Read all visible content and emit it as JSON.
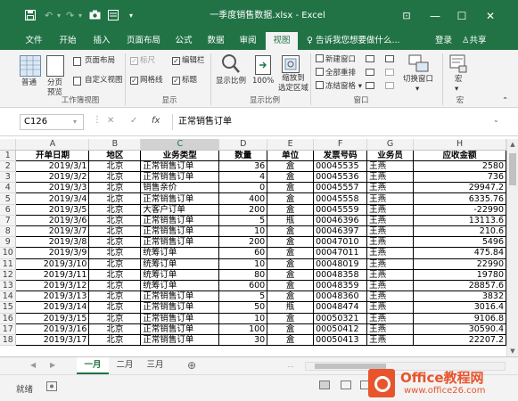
{
  "titlebar": {
    "save_icon": "save-icon",
    "undo_icon": "undo-icon",
    "redo_icon": "redo-icon",
    "camera_icon": "camera-icon",
    "form_icon": "form-icon",
    "customize": "▾",
    "title": "一季度销售数据.xlsx - Excel",
    "ribbon_display": "⊡",
    "minimize": "—",
    "maximize": "☐",
    "close": "✕"
  },
  "tabs": {
    "items": [
      "文件",
      "开始",
      "插入",
      "页面布局",
      "公式",
      "数据",
      "审阅",
      "视图"
    ],
    "active": "视图",
    "tell_me": "♀ 告诉我您想要做什么...",
    "login": "登录",
    "share": "共享"
  },
  "ribbon": {
    "workbook_views": {
      "normal": "普通",
      "page_break": "分页\n预览",
      "page_layout": "页面布局",
      "custom_views": "自定义视图",
      "label": "工作簿视图"
    },
    "show": {
      "ruler": "标尺",
      "formula_bar": "编辑栏",
      "gridlines": "网格线",
      "headings": "标题",
      "label": "显示"
    },
    "zoom": {
      "zoom": "显示比例",
      "hundred": "100%",
      "zoom_to_selection": "缩放到\n选定区域",
      "label": "显示比例"
    },
    "window": {
      "new_window": "新建窗口",
      "arrange_all": "全部重排",
      "freeze_panes": "冻结窗格",
      "switch_windows": "切换窗口",
      "label": "窗口"
    },
    "macros": {
      "macros": "宏",
      "label": "宏"
    }
  },
  "formula_bar": {
    "cell_ref": "C126",
    "cancel": "✕",
    "enter": "✓",
    "fx": "fx",
    "value": "正常销售订单"
  },
  "grid": {
    "columns": [
      "A",
      "B",
      "C",
      "D",
      "E",
      "F",
      "G",
      "H"
    ],
    "headers": [
      "开单日期",
      "地区",
      "业务类型",
      "数量",
      "单位",
      "发票号码",
      "业务员",
      "应收金额"
    ],
    "rows": [
      [
        "2019/3/1",
        "北京",
        "正常销售订单",
        "36",
        "盒",
        "00045535",
        "王燕",
        "2580"
      ],
      [
        "2019/3/2",
        "北京",
        "正常销售订单",
        "4",
        "盒",
        "00045536",
        "王燕",
        "736"
      ],
      [
        "2019/3/3",
        "北京",
        "销售亲价",
        "0",
        "盒",
        "00045557",
        "王燕",
        "29947.2"
      ],
      [
        "2019/3/4",
        "北京",
        "正常销售订单",
        "400",
        "盒",
        "00045558",
        "王燕",
        "6335.76"
      ],
      [
        "2019/3/5",
        "北京",
        "大客户订单",
        "200",
        "盒",
        "00045559",
        "王燕",
        "-22990"
      ],
      [
        "2019/3/6",
        "北京",
        "正常销售订单",
        "5",
        "瓶",
        "00046396",
        "王燕",
        "13113.6"
      ],
      [
        "2019/3/7",
        "北京",
        "正常销售订单",
        "10",
        "盒",
        "00046397",
        "王燕",
        "210.6"
      ],
      [
        "2019/3/8",
        "北京",
        "正常销售订单",
        "200",
        "盒",
        "00047010",
        "王燕",
        "5496"
      ],
      [
        "2019/3/9",
        "北京",
        "统筹订单",
        "60",
        "盒",
        "00047011",
        "王燕",
        "475.84"
      ],
      [
        "2019/3/10",
        "北京",
        "统筹订单",
        "10",
        "盒",
        "00048019",
        "王燕",
        "22990"
      ],
      [
        "2019/3/11",
        "北京",
        "统筹订单",
        "80",
        "盒",
        "00048358",
        "王燕",
        "19780"
      ],
      [
        "2019/3/12",
        "北京",
        "统筹订单",
        "600",
        "盒",
        "00048359",
        "王燕",
        "28857.6"
      ],
      [
        "2019/3/13",
        "北京",
        "正常销售订单",
        "5",
        "盒",
        "00048360",
        "王燕",
        "3832"
      ],
      [
        "2019/3/14",
        "北京",
        "正常销售订单",
        "50",
        "瓶",
        "00048474",
        "王燕",
        "3016.4"
      ],
      [
        "2019/3/15",
        "北京",
        "正常销售订单",
        "10",
        "盒",
        "00050321",
        "王燕",
        "9106.8"
      ],
      [
        "2019/3/16",
        "北京",
        "正常销售订单",
        "100",
        "盒",
        "00050412",
        "王燕",
        "30590.4"
      ],
      [
        "2019/3/17",
        "北京",
        "正常销售订单",
        "30",
        "盒",
        "00050413",
        "王燕",
        "22207.2"
      ]
    ]
  },
  "sheets": {
    "items": [
      "一月",
      "二月",
      "三月"
    ],
    "active": "一月",
    "add": "⊕",
    "prev": "◀",
    "next": "▶",
    "more": "…"
  },
  "status": {
    "ready": "就绪",
    "macro_icon": "record-macro-icon"
  },
  "watermark": {
    "brand": "Office教程网",
    "url": "www.office26.com"
  },
  "colors": {
    "excel_green": "#217346",
    "ribbon_bg": "#f3f3f3",
    "logo_orange": "#e8542c"
  }
}
